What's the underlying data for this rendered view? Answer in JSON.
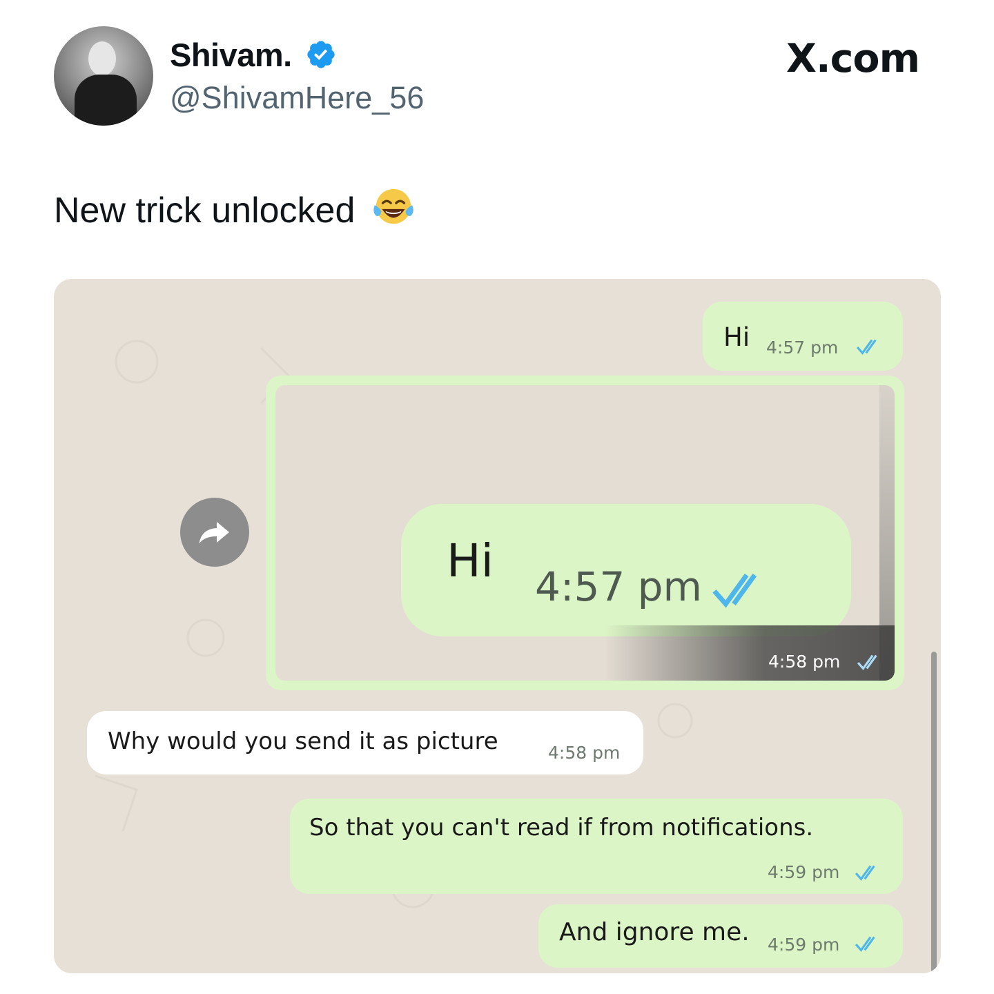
{
  "author": {
    "display_name": "Shivam.",
    "handle": "@ShivamHere_56",
    "verified": true
  },
  "site_logo": "X.com",
  "tweet": {
    "text": "New trick unlocked",
    "emoji": "face-with-tears-of-joy"
  },
  "chat": {
    "messages": [
      {
        "direction": "outgoing",
        "text": "Hi",
        "time": "4:57 pm",
        "status": "read"
      },
      {
        "direction": "outgoing",
        "type": "image",
        "image_text": "Hi",
        "image_time": "4:57 pm",
        "time": "4:58 pm",
        "status": "read"
      },
      {
        "direction": "incoming",
        "text": "Why would you send it as picture",
        "time": "4:58 pm"
      },
      {
        "direction": "outgoing",
        "text": "So that you can't read if from notifications.",
        "time": "4:59 pm",
        "status": "read"
      },
      {
        "direction": "outgoing",
        "text": "And ignore me.",
        "time": "4:59 pm",
        "status": "read"
      }
    ]
  },
  "colors": {
    "verified": "#1d9bf0",
    "outgoing_bubble": "#dcf5c6",
    "incoming_bubble": "#ffffff",
    "chat_background": "#e6e0d7",
    "read_ticks": "#4fb6ec",
    "handle_gray": "#536471"
  }
}
